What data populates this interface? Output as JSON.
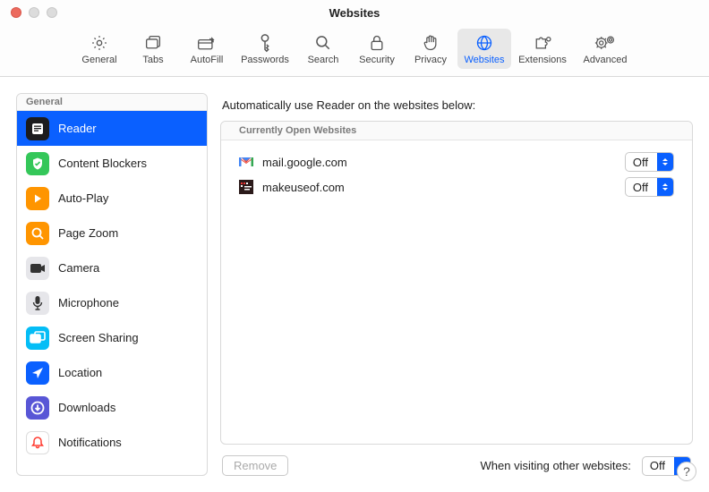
{
  "window": {
    "title": "Websites"
  },
  "toolbar": {
    "items": [
      {
        "key": "general",
        "label": "General",
        "icon": "gear"
      },
      {
        "key": "tabs",
        "label": "Tabs",
        "icon": "tabs"
      },
      {
        "key": "autofill",
        "label": "AutoFill",
        "icon": "pencil"
      },
      {
        "key": "passwords",
        "label": "Passwords",
        "icon": "key"
      },
      {
        "key": "search",
        "label": "Search",
        "icon": "magnify"
      },
      {
        "key": "security",
        "label": "Security",
        "icon": "lock"
      },
      {
        "key": "privacy",
        "label": "Privacy",
        "icon": "hand"
      },
      {
        "key": "websites",
        "label": "Websites",
        "icon": "globe",
        "active": true
      },
      {
        "key": "extensions",
        "label": "Extensions",
        "icon": "puzzle"
      },
      {
        "key": "advanced",
        "label": "Advanced",
        "icon": "gears"
      }
    ]
  },
  "sidebar": {
    "header": "General",
    "items": [
      {
        "key": "reader",
        "label": "Reader",
        "selected": true,
        "bg": "#1c1c1e",
        "icon": "reader"
      },
      {
        "key": "content-blockers",
        "label": "Content Blockers",
        "bg": "#34c759",
        "icon": "shield"
      },
      {
        "key": "auto-play",
        "label": "Auto-Play",
        "bg": "#ff9500",
        "icon": "play"
      },
      {
        "key": "page-zoom",
        "label": "Page Zoom",
        "bg": "#ff9500",
        "icon": "zoom"
      },
      {
        "key": "camera",
        "label": "Camera",
        "bg": "#e6e6ea",
        "icon": "camera"
      },
      {
        "key": "microphone",
        "label": "Microphone",
        "bg": "#e6e6ea",
        "icon": "mic"
      },
      {
        "key": "screen-sharing",
        "label": "Screen Sharing",
        "bg": "#04bdf6",
        "icon": "screens"
      },
      {
        "key": "location",
        "label": "Location",
        "bg": "#0a60ff",
        "icon": "arrow"
      },
      {
        "key": "downloads",
        "label": "Downloads",
        "bg": "#5856d6",
        "icon": "download"
      },
      {
        "key": "notifications",
        "label": "Notifications",
        "bg": "#ffffff",
        "icon": "bell"
      }
    ]
  },
  "main": {
    "title": "Automatically use Reader on the websites below:",
    "section_header": "Currently Open Websites",
    "rows": [
      {
        "site": "mail.google.com",
        "value": "Off",
        "icon": "gmail"
      },
      {
        "site": "makeuseof.com",
        "value": "Off",
        "icon": "muo"
      }
    ],
    "remove_label": "Remove",
    "other_label": "When visiting other websites:",
    "other_value": "Off"
  },
  "help": "?"
}
